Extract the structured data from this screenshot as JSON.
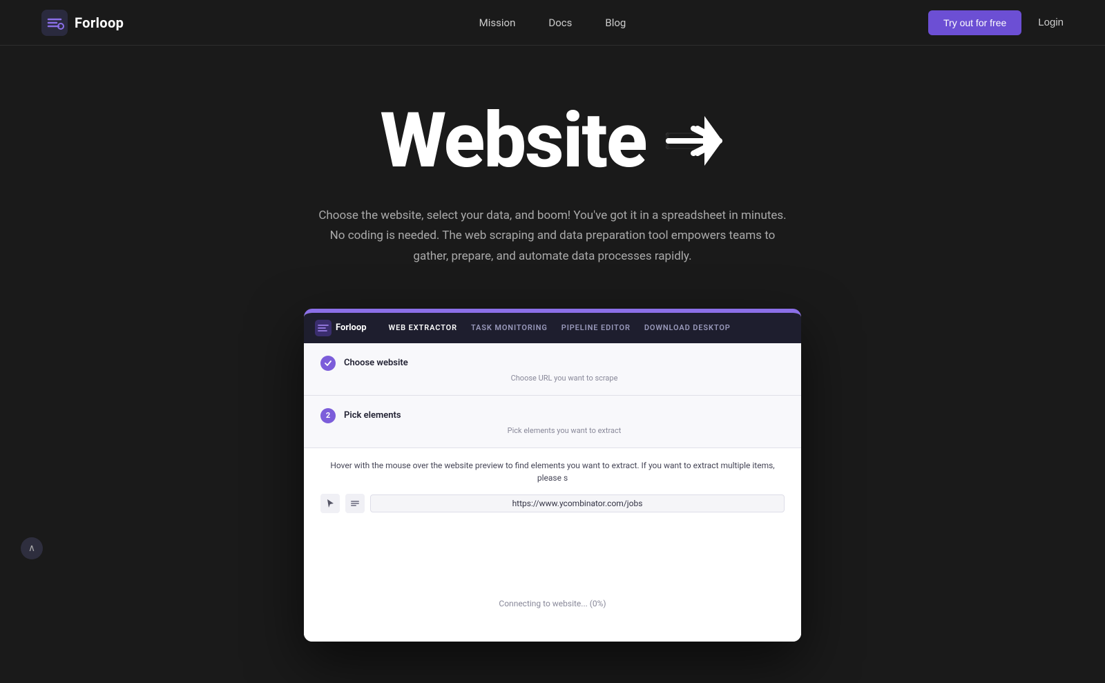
{
  "brand": {
    "name": "Forloop",
    "logo_alt": "Forloop logo"
  },
  "nav": {
    "links": [
      {
        "id": "mission",
        "label": "Mission"
      },
      {
        "id": "docs",
        "label": "Docs"
      },
      {
        "id": "blog",
        "label": "Blog"
      }
    ],
    "cta_label": "Try out for free",
    "login_label": "Login"
  },
  "hero": {
    "title": "Website",
    "arrow_symbol": "➔",
    "description": "Choose the website, select your data, and boom! You've got it in a spreadsheet in minutes. No coding is needed. The web scraping and data preparation tool empowers teams to gather, prepare, and automate data processes rapidly."
  },
  "app_screenshot": {
    "nav_items": [
      {
        "id": "web-extractor",
        "label": "WEB EXTRACTOR",
        "active": true
      },
      {
        "id": "task-monitoring",
        "label": "TASK MONITORING",
        "active": false
      },
      {
        "id": "pipeline-editor",
        "label": "PIPELINE EDITOR",
        "active": false
      },
      {
        "id": "download-desktop",
        "label": "DOWNLOAD DESKTOP",
        "active": false
      }
    ],
    "steps": [
      {
        "id": "step1",
        "title": "Choose website",
        "subtitle": "Choose URL you want to scrape",
        "completed": true,
        "number": "✓"
      },
      {
        "id": "step2",
        "title": "Pick elements",
        "subtitle": "Pick elements you want to extract",
        "completed": false,
        "number": "2"
      }
    ],
    "hover_instruction": "Hover with the mouse over the website preview to find elements you want to extract. If you want to extract multiple items, please s",
    "url_value": "https://www.ycombinator.com/jobs",
    "connecting_text": "Connecting to website... (0%)"
  },
  "scroll_indicator": {
    "icon": "∧"
  },
  "colors": {
    "bg": "#1a1a1a",
    "accent": "#7c5dda",
    "nav_bg": "#1e1e2e",
    "cta_bg": "#6c4fd4"
  }
}
